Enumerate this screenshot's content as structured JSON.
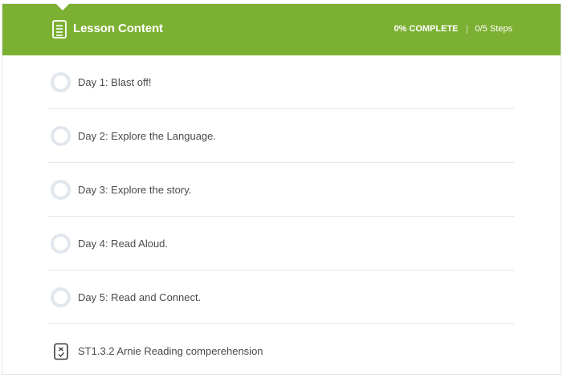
{
  "header": {
    "title": "Lesson Content",
    "progress": "0% COMPLETE",
    "steps": "0/5 Steps",
    "accent_color": "#7cb032"
  },
  "lessons": [
    {
      "label": "Day 1: Blast off!",
      "icon": "incomplete-circle-icon"
    },
    {
      "label": "Day 2: Explore the Language.",
      "icon": "incomplete-circle-icon"
    },
    {
      "label": "Day 3: Explore the story.",
      "icon": "incomplete-circle-icon"
    },
    {
      "label": "Day 4: Read Aloud.",
      "icon": "incomplete-circle-icon"
    },
    {
      "label": "Day 5: Read and Connect.",
      "icon": "incomplete-circle-icon"
    }
  ],
  "quiz": {
    "label": "ST1.3.2 Arnie Reading comperehension",
    "icon": "quiz-icon"
  }
}
